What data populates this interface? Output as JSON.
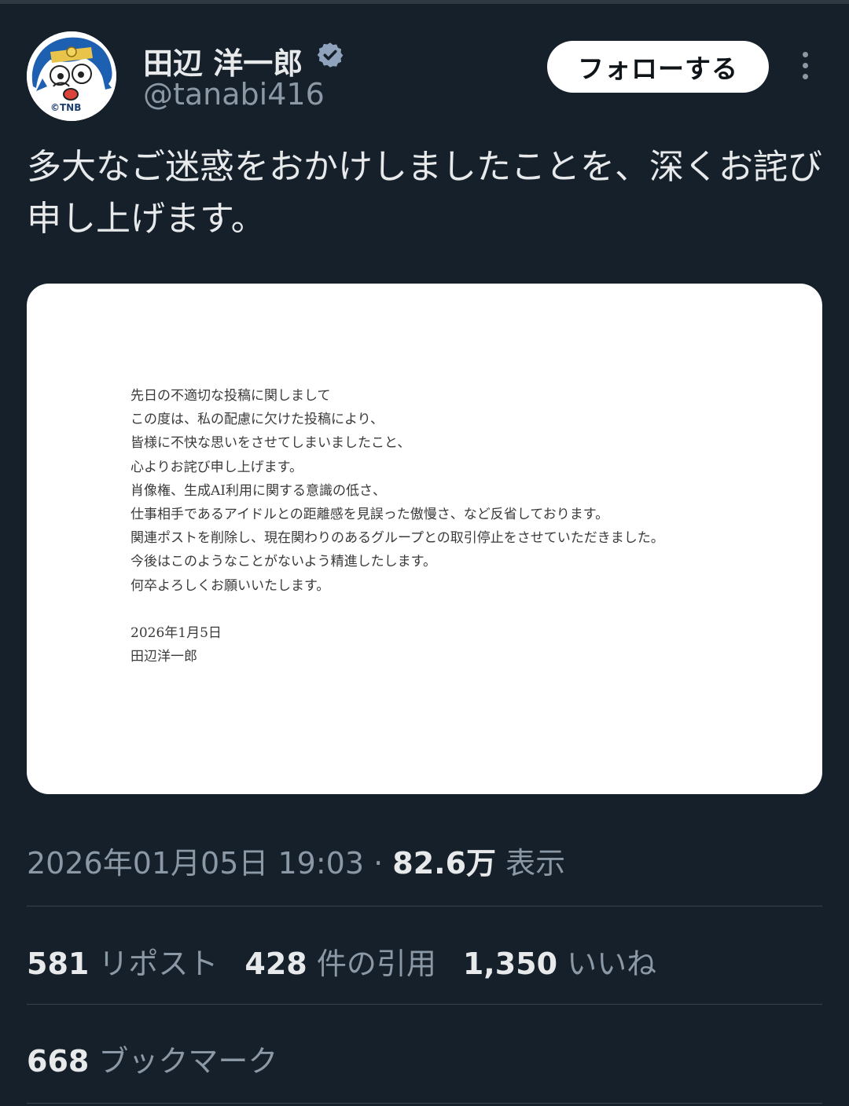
{
  "author": {
    "name": "田辺 洋一郎",
    "handle": "@tanabi416",
    "avatar_text": "©TNB",
    "verified_icon": "verified-badge-icon"
  },
  "actions": {
    "follow_label": "フォローする",
    "more_icon": "more-vertical-icon"
  },
  "tweet": {
    "text": "多大なご迷惑をおかけしましたことを、深くお詫び申し上げます。"
  },
  "attachment": {
    "lines": [
      "先日の不適切な投稿に関しまして",
      "この度は、私の配慮に欠けた投稿により、",
      "皆様に不快な思いをさせてしまいましたこと、",
      "心よりお詫び申し上げます。",
      "肖像権、生成AI利用に関する意識の低さ、",
      "仕事相手であるアイドルとの距離感を見誤った傲慢さ、など反省しております。",
      "関連ポストを削除し、現在関わりのあるグループとの取引停止をさせていただきました。",
      "今後はこのようなことがないよう精進したします。",
      "何卒よろしくお願いいたします。"
    ],
    "date": "2026年1月5日",
    "signature": "田辺洋一郎"
  },
  "meta": {
    "timestamp": "2026年01月05日 19:03",
    "separator": " · ",
    "views_count": "82.6万",
    "views_label": " 表示"
  },
  "stats": [
    {
      "count": "581",
      "label": " リポスト"
    },
    {
      "count": "428",
      "label": " 件の引用"
    },
    {
      "count": "1,350",
      "label": " いいね"
    }
  ],
  "bookmarks": {
    "count": "668",
    "label": " ブックマーク"
  },
  "colors": {
    "background": "#15202b",
    "text_primary": "#e7e9ea",
    "text_secondary": "#8b98a5",
    "verified": "#8fa3bc",
    "divider": "#38444d"
  }
}
